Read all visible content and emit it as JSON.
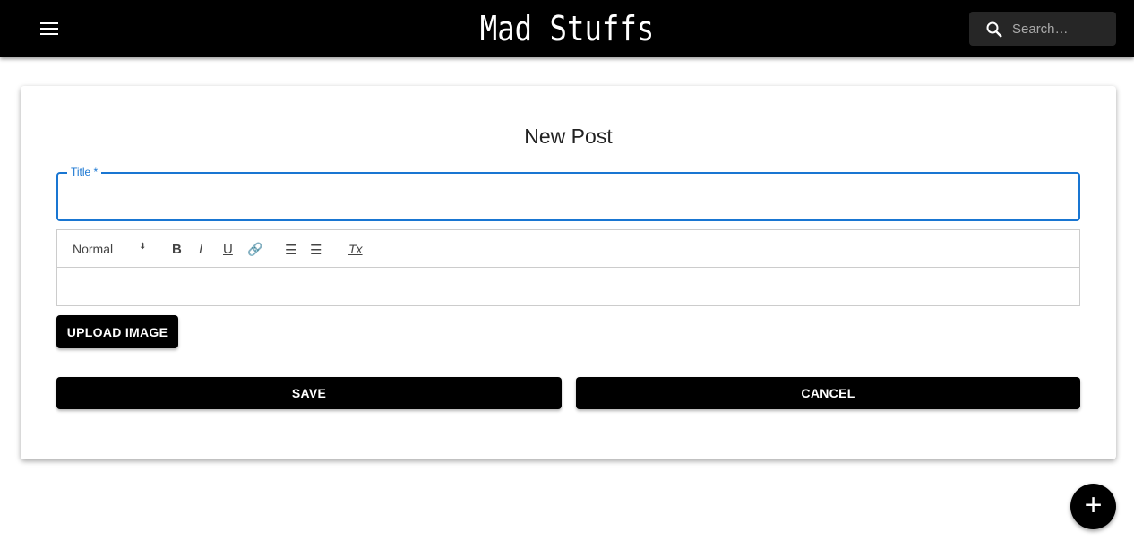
{
  "header": {
    "brand": "Mad Stuffs",
    "search_placeholder": "Search…"
  },
  "form": {
    "heading": "New Post",
    "title_label": "Title *",
    "title_value": "",
    "toolbar": {
      "format": "Normal",
      "bold": "B",
      "italic": "I",
      "underline": "U",
      "clean": "Tx"
    },
    "upload_label": "UPLOAD IMAGE",
    "save_label": "SAVE",
    "cancel_label": "CANCEL"
  },
  "fab": {
    "label": "+"
  }
}
